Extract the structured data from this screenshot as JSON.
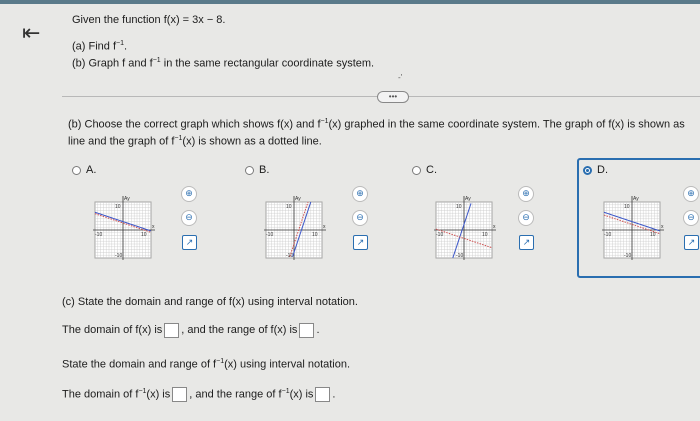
{
  "header": {
    "back_icon": "back-arrow-icon"
  },
  "question": {
    "intro": "Given the function f(x) = 3x − 8.",
    "part_a_prefix": "(a) Find f",
    "part_a_sup": "−1",
    "part_a_suffix": ".",
    "part_b_prefix": "(b) Graph f and f",
    "part_b_sup": "−1",
    "part_b_suffix": " in the same rectangular coordinate system."
  },
  "more_label": "•••",
  "part_b": {
    "line1_a": "(b) Choose the correct graph which shows f(x) and f",
    "line1_sup": "−1",
    "line1_b": "(x) graphed in the same coordinate system. The graph of f(x) is shown as",
    "line2_a": "line and the graph of f",
    "line2_sup": "−1",
    "line2_b": "(x) is shown as a dotted line."
  },
  "options": [
    {
      "label": "A.",
      "selected": false
    },
    {
      "label": "B.",
      "selected": false
    },
    {
      "label": "C.",
      "selected": false
    },
    {
      "label": "D.",
      "selected": true
    }
  ],
  "graph_labels": {
    "ytick": "10",
    "xtick": "10",
    "xneg": "-10",
    "yneg": "-10",
    "ylab": "Ay",
    "xlab": "x"
  },
  "part_c": {
    "title": "(c) State the domain and range of f(x) using interval notation.",
    "line1_a": "The domain of f(x) is",
    "line1_b": ", and the range of f(x) is",
    "line1_c": ".",
    "line2": "State the domain and range of f",
    "line2_sup": "−1",
    "line2_b": "(x) using interval notation.",
    "line3_a": "The domain of f",
    "line3_sup": "−1",
    "line3_b": "(x) is",
    "line3_c": ", and the range of f",
    "line3_sup2": "−1",
    "line3_d": "(x) is",
    "line3_e": "."
  },
  "colors": {
    "accent": "#2a6eb0",
    "graph_line": "#3a55c8",
    "graph_dot": "#d05050"
  }
}
